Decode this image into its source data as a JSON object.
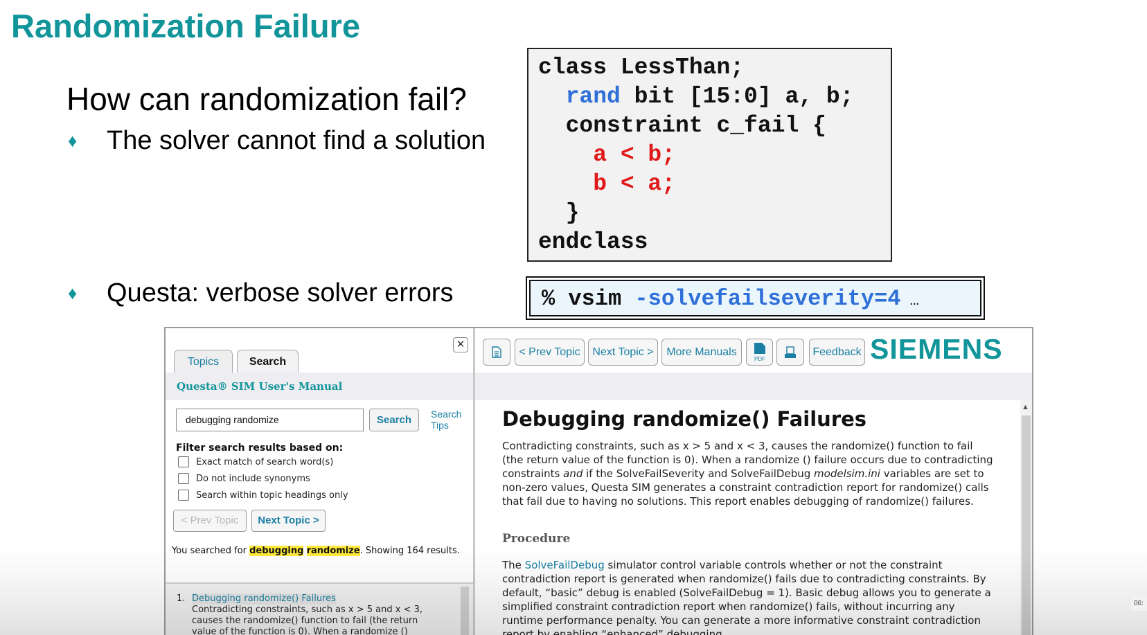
{
  "slide": {
    "title": "Randomization Failure",
    "question": "How can randomization fail?",
    "bullets": [
      "The solver cannot find a solution",
      "Questa: verbose solver errors"
    ],
    "bullet_glyph": "♦",
    "code_lines": {
      "l1": "class LessThan;",
      "l2_kw": "rand",
      "l2_rest": " bit [15:0] a, b;",
      "l3": "constraint c_fail {",
      "l4": "a < b;",
      "l5": "b < a;",
      "l6": "}",
      "l7": "endclass"
    },
    "command": {
      "prompt": "% vsim ",
      "flag": "-solvefailseverity=4",
      "ellipsis": " …"
    }
  },
  "help_window": {
    "close_glyph": "✕",
    "tabs": [
      "Topics",
      "Search"
    ],
    "manual_title": "Questa® SIM User's Manual",
    "search_value": "debugging randomize",
    "search_button": "Search",
    "search_tips": "Search Tips",
    "filter_heading": "Filter search results based on:",
    "filters": [
      "Exact match of search word(s)",
      "Do not include synonyms",
      "Search within topic headings only"
    ],
    "prev_topic": "< Prev Topic",
    "next_topic": "Next Topic >",
    "summary_prefix": "You searched for ",
    "summary_term1": "debugging",
    "summary_term2": "randomize",
    "summary_suffix": ". Showing 164 results.",
    "result": {
      "number": "1.",
      "title": "Debugging randomize() Failures",
      "desc": "Contradicting constraints, such as x > 5 and x < 3, causes the randomize() function to fail (the return value of the function is 0). When a randomize ()"
    },
    "toolbar": {
      "prev": "< Prev Topic",
      "next": "Next Topic >",
      "more": "More Manuals",
      "pdf": "PDF",
      "feedback": "Feedback",
      "brand": "SIEMENS"
    },
    "article": {
      "title": "Debugging randomize() Failures",
      "p1_a": "Contradicting constraints, such as x > 5 and x < 3, causes the randomize() function to fail (the return value of the function is 0). When a randomize () failure occurs due to contradicting constraints ",
      "p1_and": "and",
      "p1_b": " if the SolveFailSeverity and SolveFailDebug ",
      "p1_ini": "modelsim.ini",
      "p1_c": " variables are set to non-zero values, Questa SIM generates a constraint contradiction report for randomize() calls that fail due to having no solutions. This report enables debugging of randomize() failures.",
      "procedure": "Procedure",
      "p2_a": "The ",
      "p2_link": "SolveFailDebug",
      "p2_b": " simulator control variable controls whether or not the constraint contradiction report is generated when randomize() fails due to contradicting constraints. By default, “basic” debug is enabled (SolveFailDebug = 1). Basic debug allows you to generate a simplified constraint contradiction report when randomize() fails, without incurring any runtime performance penalty. You can generate a more informative constraint contradiction report by enabling “enhanced” debugging"
    }
  },
  "timestamp": "06:",
  "colors": {
    "accent": "#12959a",
    "link": "#1a7fa3",
    "code_blue": "#2f6fd8",
    "code_red": "#e01818",
    "highlight": "#ffea3b"
  }
}
